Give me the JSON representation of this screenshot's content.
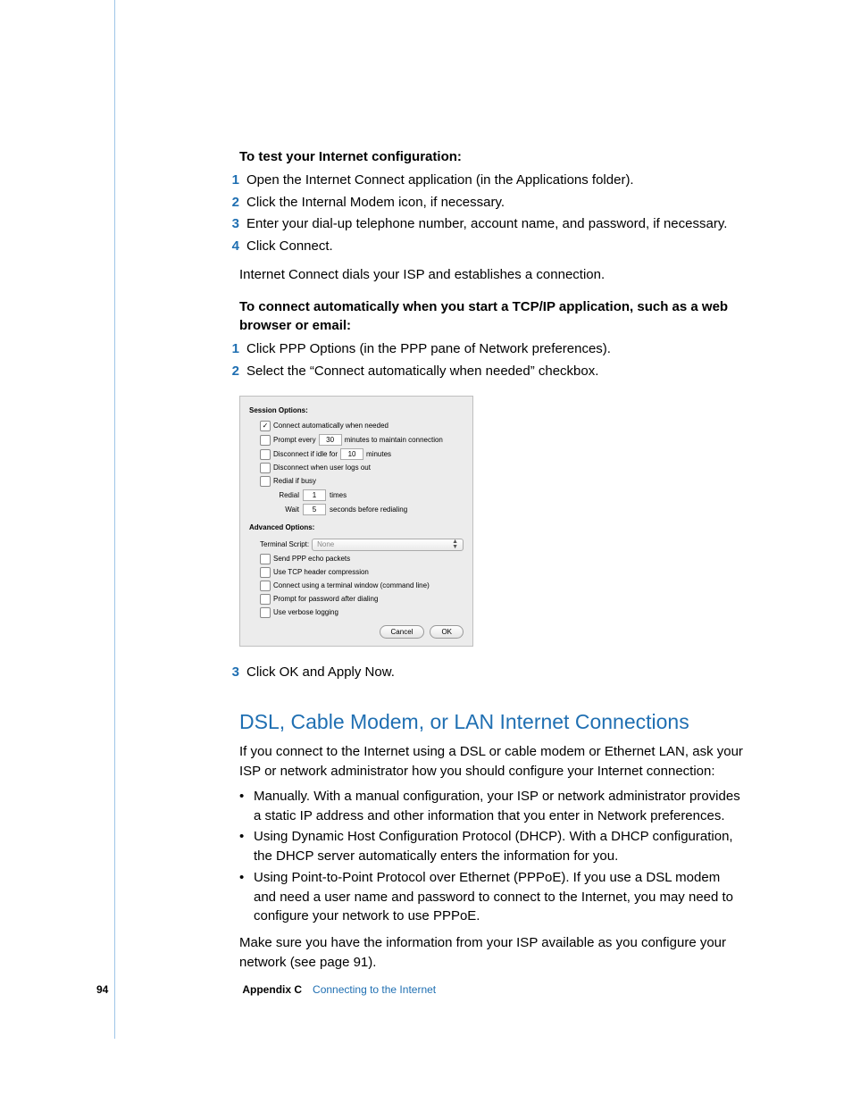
{
  "section1_title": "To test your Internet configuration:",
  "steps1": [
    "Open the Internet Connect application (in the Applications folder).",
    "Click the Internal Modem icon, if necessary.",
    "Enter your dial-up telephone number, account name, and password, if necessary.",
    "Click Connect."
  ],
  "after_steps1": "Internet Connect dials your ISP and establishes a connection.",
  "section2_title": "To connect automatically when you start a TCP/IP application, such as a web browser or email:",
  "steps2": [
    "Click PPP Options (in the PPP pane of Network preferences).",
    "Select the “Connect automatically when needed” checkbox."
  ],
  "dialog": {
    "session_title": "Session Options:",
    "connect_auto": "Connect automatically when needed",
    "prompt_every_a": "Prompt every",
    "prompt_every_val": "30",
    "prompt_every_b": "minutes to maintain connection",
    "disconnect_idle_a": "Disconnect if idle for",
    "disconnect_idle_val": "10",
    "disconnect_idle_b": "minutes",
    "disconnect_logout": "Disconnect when user logs out",
    "redial_busy": "Redial if busy",
    "redial_lbl": "Redial",
    "redial_val": "1",
    "redial_unit": "times",
    "wait_lbl": "Wait",
    "wait_val": "5",
    "wait_unit": "seconds before redialing",
    "advanced_title": "Advanced Options:",
    "terminal_script": "Terminal Script:",
    "terminal_none": "None",
    "send_echo": "Send PPP echo packets",
    "tcp_header": "Use TCP header compression",
    "connect_terminal": "Connect using a terminal window (command line)",
    "prompt_password": "Prompt for password after dialing",
    "verbose": "Use verbose logging",
    "cancel": "Cancel",
    "ok": "OK"
  },
  "steps3": [
    "Click OK and Apply Now."
  ],
  "heading": "DSL, Cable Modem, or LAN Internet Connections",
  "dsl_intro": "If you connect to the Internet using a DSL or cable modem or Ethernet LAN, ask your ISP or network administrator how you should configure your Internet connection:",
  "bullets": [
    "Manually. With a manual configuration, your ISP or network administrator provides a static IP address and other information that you enter in Network preferences.",
    "Using Dynamic Host Configuration Protocol (DHCP). With a DHCP configuration, the DHCP server automatically enters the information for you.",
    "Using Point-to-Point Protocol over Ethernet (PPPoE). If you use a DSL modem and need a user name and password to connect to the Internet, you may need to configure your network to use PPPoE."
  ],
  "closing": "Make sure you have the information from your ISP available as you configure your network (see page 91).",
  "footer": {
    "page": "94",
    "appendix": "Appendix C",
    "chapter": "Connecting to the Internet"
  }
}
